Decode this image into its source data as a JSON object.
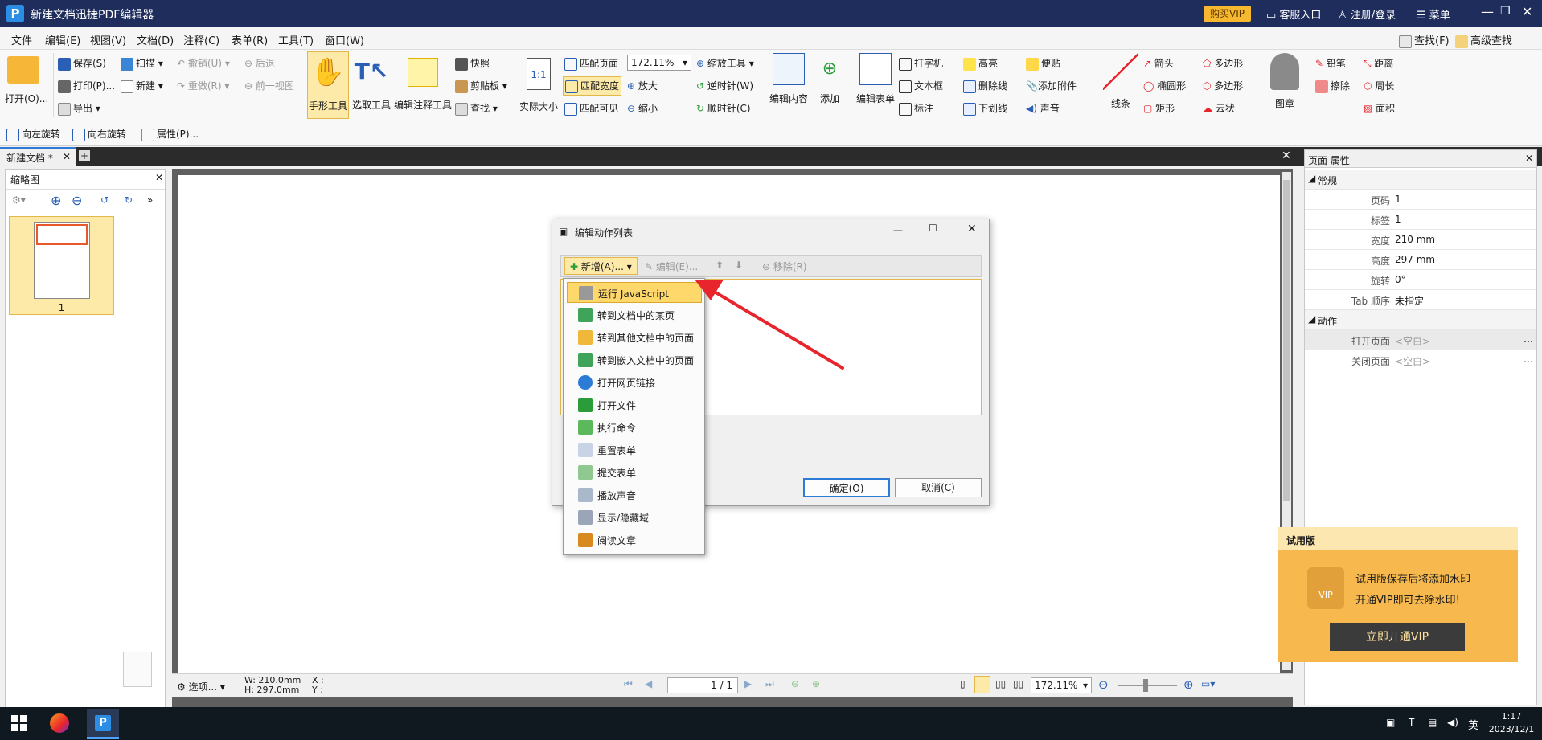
{
  "titlebar": {
    "app_title": "新建文档迅捷PDF编辑器",
    "vip_button": "购买VIP",
    "support": "客服入口",
    "login": "注册/登录",
    "menu": "菜单"
  },
  "menus": [
    "文件",
    "编辑(E)",
    "视图(V)",
    "文档(D)",
    "注释(C)",
    "表单(R)",
    "工具(T)",
    "窗口(W)"
  ],
  "search": {
    "find": "查找(F)",
    "advanced_find": "高级查找"
  },
  "ribbon": {
    "open": "打开(O)...",
    "save": "保存(S)",
    "print": "打印(P)...",
    "export": "导出",
    "scan": "扫描",
    "new": "新建",
    "undo": "撤销(U)",
    "redo": "重做(R)",
    "back": "后退",
    "prev_view": "前一视图",
    "hand_tool": "手形工具",
    "select_tool": "选取工具",
    "edit_annot_tool": "编辑注释工具",
    "snapshot": "快照",
    "clipboard": "剪贴板",
    "find": "查找",
    "actual_size": "实际大小",
    "fit_page": "匹配页面",
    "fit_width": "匹配宽度",
    "fit_visible": "匹配可见",
    "zoom_value": "172.11%",
    "zoom_in": "放大",
    "zoom_out": "缩小",
    "zoom_tool": "缩放工具",
    "rotate_ccw": "逆时针(W)",
    "rotate_cw": "顺时针(C)",
    "edit_content": "编辑内容",
    "add": "添加",
    "edit_form": "编辑表单",
    "typewriter": "打字机",
    "textbox": "文本框",
    "callout": "标注",
    "highlight": "高亮",
    "strikeout": "删除线",
    "underline": "下划线",
    "note": "便贴",
    "attach": "添加附件",
    "sound": "声音",
    "line": "线条",
    "arrow": "箭头",
    "ellipse": "椭圆形",
    "rectangle": "矩形",
    "polygon": "多边形",
    "polyline": "多边形",
    "cloud": "云状",
    "stamp": "图章",
    "pencil": "铅笔",
    "eraser": "擦除",
    "distance": "距离",
    "perimeter": "周长",
    "area": "面积"
  },
  "subbar": {
    "rotate_left": "向左旋转",
    "rotate_right": "向右旋转",
    "properties": "属性(P)..."
  },
  "tab": {
    "label": "新建文档 *"
  },
  "thumbnail": {
    "title": "缩略图",
    "page_label": "1"
  },
  "right_panel": {
    "title": "页面 属性",
    "section_general": "常规",
    "rows": [
      {
        "k": "页码",
        "v": "1"
      },
      {
        "k": "标签",
        "v": "1"
      },
      {
        "k": "宽度",
        "v": "210 mm"
      },
      {
        "k": "高度",
        "v": "297 mm"
      },
      {
        "k": "旋转",
        "v": "0°"
      },
      {
        "k": "Tab 顺序",
        "v": "未指定"
      }
    ],
    "section_action": "动作",
    "action_rows": [
      {
        "k": "打开页面",
        "v": "<空白>"
      },
      {
        "k": "关闭页面",
        "v": "<空白>"
      }
    ]
  },
  "dialog": {
    "title": "编辑动作列表",
    "add": "新增(A)...",
    "edit": "编辑(E)...",
    "remove": "移除(R)",
    "ok": "确定(O)",
    "cancel": "取消(C)"
  },
  "dropdown_items": [
    "运行 JavaScript",
    "转到文档中的某页",
    "转到其他文档中的页面",
    "转到嵌入文档中的页面",
    "打开网页链接",
    "打开文件",
    "执行命令",
    "重置表单",
    "提交表单",
    "播放声音",
    "显示/隐藏域",
    "阅读文章"
  ],
  "status": {
    "options": "选项...",
    "w": "W: 210.0mm",
    "h": "H: 297.0mm",
    "x": "X :",
    "y": "Y :",
    "page": "1 / 1",
    "zoom": "172.11%"
  },
  "trial": {
    "title": "试用版",
    "line1": "试用版保存后将添加水印",
    "line2": "开通VIP即可去除水印!",
    "button": "立即开通VIP",
    "badge": "VIP"
  },
  "taskbar": {
    "time": "1:17",
    "date": "2023/12/1",
    "ime": "英"
  },
  "colors": {
    "title_bg": "#1e2d5c",
    "vip": "#f5b82e",
    "accent": "#2b7bd7",
    "menu_highlight": "#ffd86b",
    "arrow": "#e8242c"
  }
}
